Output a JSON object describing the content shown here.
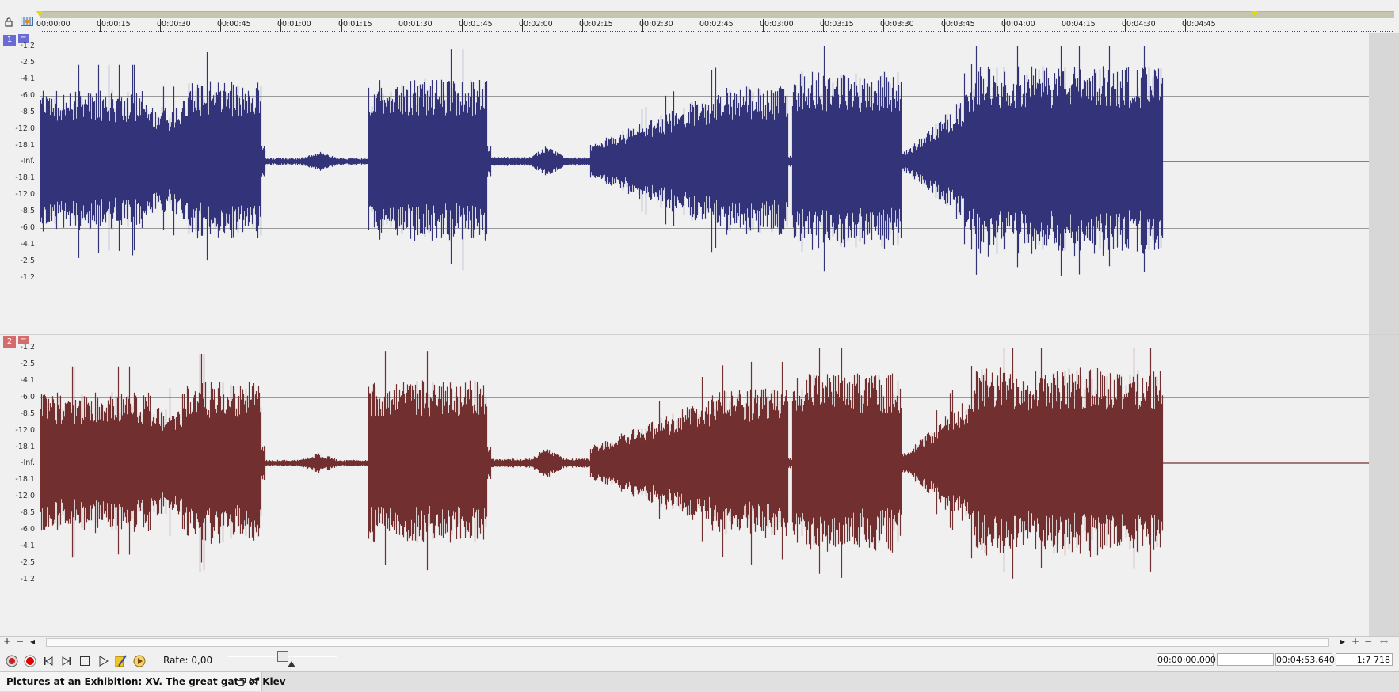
{
  "ruler": {
    "ticks": [
      "00:00:00",
      "00:00:15",
      "00:00:30",
      "00:00:45",
      "00:01:00",
      "00:01:15",
      "00:01:30",
      "00:01:45",
      "00:02:00",
      "00:02:15",
      "00:02:30",
      "00:02:45",
      "00:03:00",
      "00:03:15",
      "00:03:30",
      "00:03:45",
      "00:04:00",
      "00:04:15",
      "00:04:30",
      "00:04:45"
    ]
  },
  "channels": [
    {
      "number": "1",
      "collapse": "−",
      "color": "#33337a",
      "badge_color": "#6b6bd6",
      "scale": [
        "-1.2",
        "-2.5",
        "-4.1",
        "-6.0",
        "-8.5",
        "-12.0",
        "-18.1",
        "-Inf.",
        "-18.1",
        "-12.0",
        "-8.5",
        "-6.0",
        "-4.1",
        "-2.5",
        "-1.2"
      ]
    },
    {
      "number": "2",
      "collapse": "−",
      "color": "#722f2f",
      "badge_color": "#d66b6b",
      "scale": [
        "-1.2",
        "-2.5",
        "-4.1",
        "-6.0",
        "-8.5",
        "-12.0",
        "-18.1",
        "-Inf.",
        "-18.1",
        "-12.0",
        "-8.5",
        "-6.0",
        "-4.1",
        "-2.5",
        "-1.2"
      ]
    }
  ],
  "transport": {
    "rate_label": "Rate: 0,00",
    "cursor_time": "00:00:00,000",
    "selection_length": "",
    "total_length": "00:04:53,640",
    "zoom_ratio": "1:7 718"
  },
  "document": {
    "title": "Pictures at an Exhibition: XV. The great gate of Kiev",
    "close_label": "✕"
  }
}
